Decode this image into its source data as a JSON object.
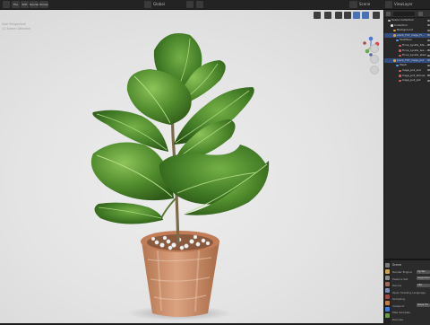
{
  "topbar": {
    "menus": [
      "File",
      "Edit",
      "Render",
      "Window",
      "Help"
    ],
    "viewport_shading": "Global",
    "scene": "Scene",
    "view_layer": "ViewLayer"
  },
  "viewport": {
    "info_lines": [
      "User Perspective",
      "(1) Scene Collection"
    ]
  },
  "outliner": {
    "rows": [
      {
        "label": "Scene Collection",
        "indent": 1,
        "color": "#bbbbbb",
        "selected": false
      },
      {
        "label": "Collection",
        "indent": 2,
        "color": "#e0e0e0",
        "selected": false
      },
      {
        "label": "Background",
        "indent": 3,
        "color": "#e0a040",
        "selected": false
      },
      {
        "label": "plant_F07_Cage_Fi...",
        "indent": 3,
        "color": "#e0a040",
        "selected": true
      },
      {
        "label": "Modifiers",
        "indent": 4,
        "color": "#5aa0e0",
        "selected": false
      },
      {
        "label": "Ficus_Lyrata_Ste...",
        "indent": 5,
        "color": "#e05a5a",
        "selected": false
      },
      {
        "label": "Ficus_Lyrata_lea...",
        "indent": 5,
        "color": "#e05a5a",
        "selected": false
      },
      {
        "label": "Ficus_Lyrata_stem",
        "indent": 5,
        "color": "#e05a5a",
        "selected": false
      },
      {
        "label": "plant_F07_Cage_pot",
        "indent": 3,
        "color": "#e0a040",
        "selected": true
      },
      {
        "label": "Mesh",
        "indent": 4,
        "color": "#5aa0e0",
        "selected": false
      },
      {
        "label": "Cage_pot_soil",
        "indent": 5,
        "color": "#e05a5a",
        "selected": false
      },
      {
        "label": "Cage_pot_stones",
        "indent": 5,
        "color": "#e05a5a",
        "selected": false
      },
      {
        "label": "Cage_pot_pot",
        "indent": 5,
        "color": "#e05a5a",
        "selected": false
      }
    ]
  },
  "properties": {
    "title": "Scene",
    "rows": [
      {
        "label": "Render Engine",
        "value": "Cycles"
      },
      {
        "label": "Feature Set",
        "value": "Supported"
      },
      {
        "label": "Device",
        "value": "CPU"
      },
      {
        "label": "Open Shading Language",
        "value": ""
      },
      {
        "label": "Sampling",
        "value": ""
      },
      {
        "label": "Viewport",
        "value": "Noise Thr"
      },
      {
        "label": "Max Samples",
        "value": ""
      },
      {
        "label": "Denoise",
        "value": ""
      }
    ]
  },
  "colors": {
    "accent": "#4772b3",
    "selection": "#334d80",
    "leaf": "#4f8a2c",
    "pot": "#c98a66"
  }
}
